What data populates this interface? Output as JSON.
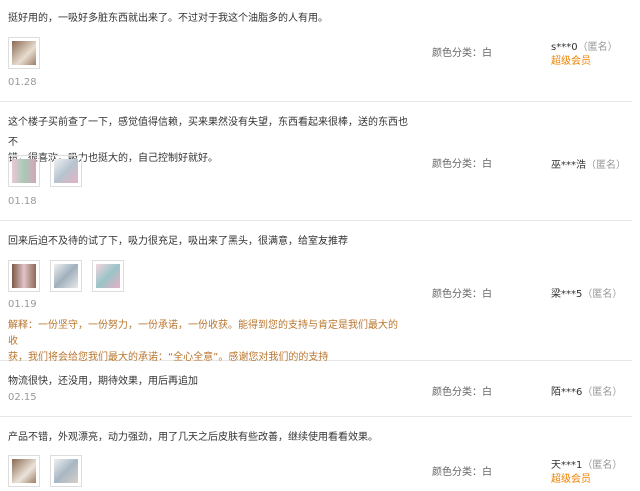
{
  "reviews": [
    {
      "text": "挺好用的，一吸好多脏东西就出来了。不过对于我这个油脂多的人有用。",
      "date": "01.28",
      "color_label": "颜色分类：白",
      "user": "s***0",
      "anon": "（匿名）",
      "badge": "超级会员",
      "thumbs": [
        "#c9a98a"
      ]
    },
    {
      "text_lines": [
        "这个楼子买前查了一下，感觉值得信赖，买来果然没有失望，东西看起来很棒，送的东西也不",
        "错，很喜欢。吸力也挺大的，自己控制好就好。"
      ],
      "date": "01.18",
      "color_label": "颜色分类：白",
      "user": "巫***浩",
      "anon": "（匿名）",
      "thumbs": [
        "#d8b7c2",
        "#cfd6de"
      ]
    },
    {
      "text": "回来后迫不及待的试了下，吸力很充足，吸出来了黑头，很满意，给室友推荐",
      "date": "01.19",
      "reply_lines": [
        "解释：一份坚守，一份努力，一份承诺，一份收获。能得到您的支持与肯定是我们最大的收",
        "获，我们将会给您我们最大的承诺：“全心全意”。感谢您对我们的的支持"
      ],
      "color_label": "颜色分类：白",
      "user": "梁***5",
      "anon": "（匿名）",
      "thumbs": [
        "#b89a86",
        "#c8d3dc",
        "#e3b8c8"
      ]
    },
    {
      "text": "物流很快，还没用，期待效果，用后再追加",
      "date": "02.15",
      "color_label": "颜色分类：白",
      "user": "陌***6",
      "anon": "（匿名）",
      "thumbs": []
    },
    {
      "text": "产品不错，外观漂亮，动力强劲，用了几天之后皮肤有些改善，继续使用看看效果。",
      "color_label": "颜色分类：白",
      "user": "天***1",
      "anon": "（匿名）",
      "badge": "超级会员",
      "thumbs": [
        "#c9a98a",
        "#cdd6de"
      ]
    }
  ]
}
